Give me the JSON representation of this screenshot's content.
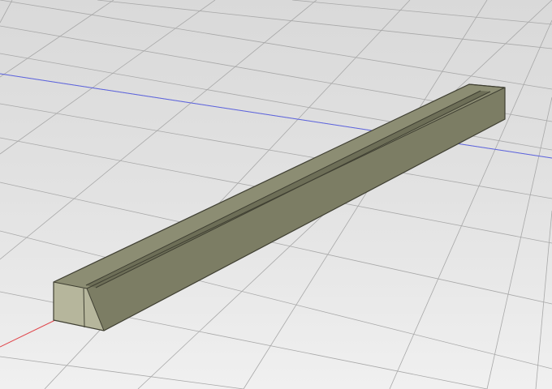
{
  "viewport": {
    "kind": "3d-model-view",
    "background_top": "#d9d9d9",
    "background_bottom": "#f0f0f0"
  },
  "grid": {
    "visible": true,
    "line_color": "#a8a8a8",
    "x_axis_color": "#e0474c",
    "y_axis_color": "#5c63e0"
  },
  "model": {
    "shape": "rectangular bar with top groove",
    "colors": {
      "top": "#8c8d73",
      "front": "#7c7d64",
      "end": "#b6b69c",
      "edge": "#3f3f32",
      "groove": "#6d6e57"
    }
  }
}
